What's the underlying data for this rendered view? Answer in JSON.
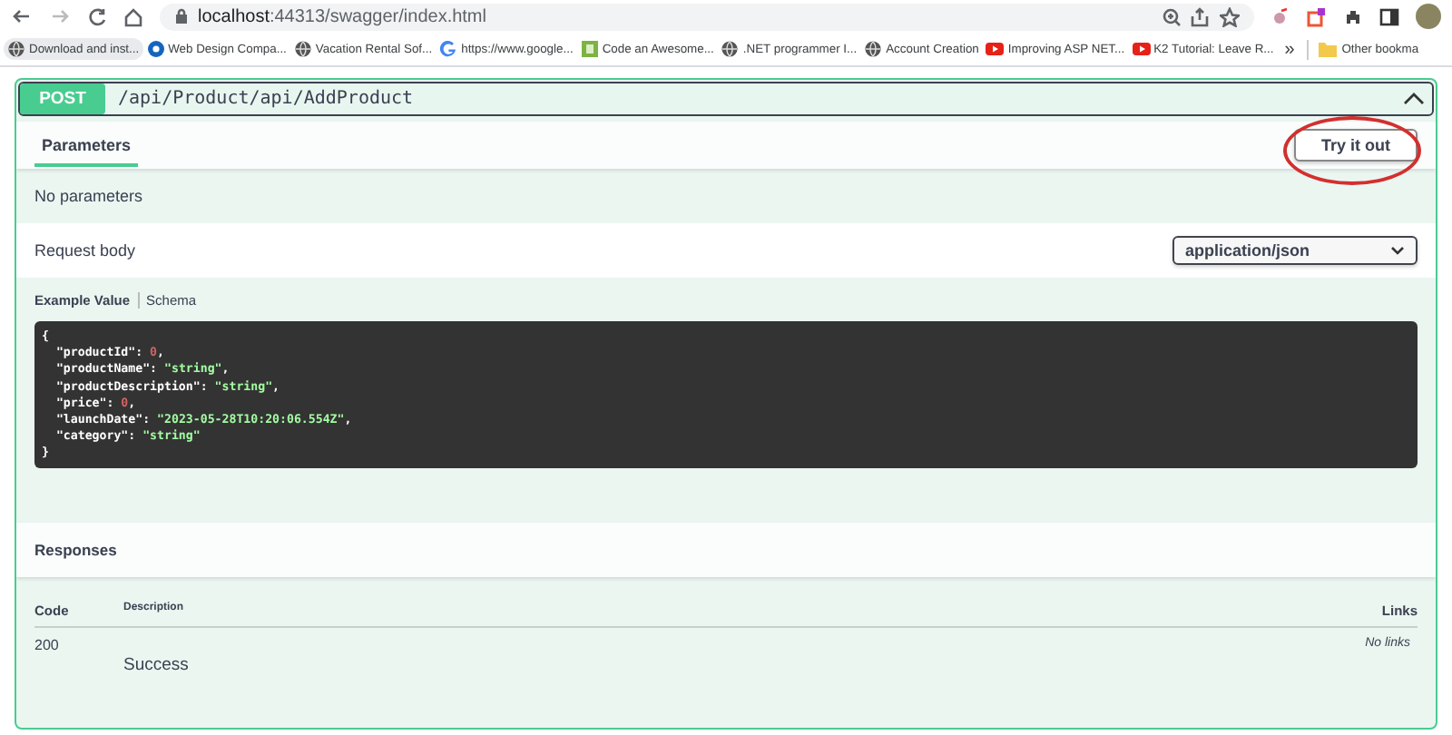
{
  "browser": {
    "url_host": "localhost",
    "url_path": ":44313/swagger/index.html"
  },
  "bookmarks": [
    {
      "label": "Download and inst...",
      "kind": "globe",
      "selected": true
    },
    {
      "label": "Web Design Compa...",
      "kind": "disc",
      "selected": false
    },
    {
      "label": "Vacation Rental Sof...",
      "kind": "globe",
      "selected": false
    },
    {
      "label": "https://www.google...",
      "kind": "google",
      "selected": false
    },
    {
      "label": "Code an Awesome...",
      "kind": "square",
      "selected": false
    },
    {
      "label": ".NET programmer I...",
      "kind": "globe",
      "selected": false
    },
    {
      "label": "Account Creation",
      "kind": "globe",
      "selected": false
    },
    {
      "label": "Improving ASP NET...",
      "kind": "video",
      "selected": false
    },
    {
      "label": "K2 Tutorial: Leave R...",
      "kind": "video",
      "selected": false
    }
  ],
  "bookmarks_more": "»",
  "other_bookmarks": "Other bookma",
  "operation": {
    "method": "POST",
    "path": "/api/Product/api/AddProduct",
    "expanded": true,
    "tabs": [
      {
        "label": "Parameters",
        "selected": true
      }
    ],
    "try_button": "Try it out",
    "try_highlighted": true,
    "no_params": "No parameters",
    "request_body": "Request body",
    "content_type": "application/json",
    "example_tabs": [
      {
        "label": "Example Value",
        "selected": true
      },
      {
        "label": "Schema",
        "selected": false
      }
    ],
    "example": {
      "open": "{",
      "close": "}",
      "fields": [
        {
          "key": "\"productId\":",
          "value": "0",
          "kind": "number",
          "end": ","
        },
        {
          "key": "\"productName\":",
          "value": "\"string\"",
          "kind": "string",
          "end": ","
        },
        {
          "key": "\"productDescription\":",
          "value": "\"string\"",
          "kind": "string",
          "end": ","
        },
        {
          "key": "\"price\":",
          "value": "0",
          "kind": "number",
          "end": ","
        },
        {
          "key": "\"launchDate\":",
          "value": "\"2023-05-28T10:20:06.554Z\"",
          "kind": "string",
          "end": ","
        },
        {
          "key": "\"category\":",
          "value": "\"string\"",
          "kind": "string"
        }
      ]
    },
    "responses_title": "Responses",
    "columns": [
      "Code",
      "Description",
      "Links"
    ],
    "rows": [
      {
        "code": "200",
        "description": "Success",
        "links": "No links"
      }
    ]
  }
}
